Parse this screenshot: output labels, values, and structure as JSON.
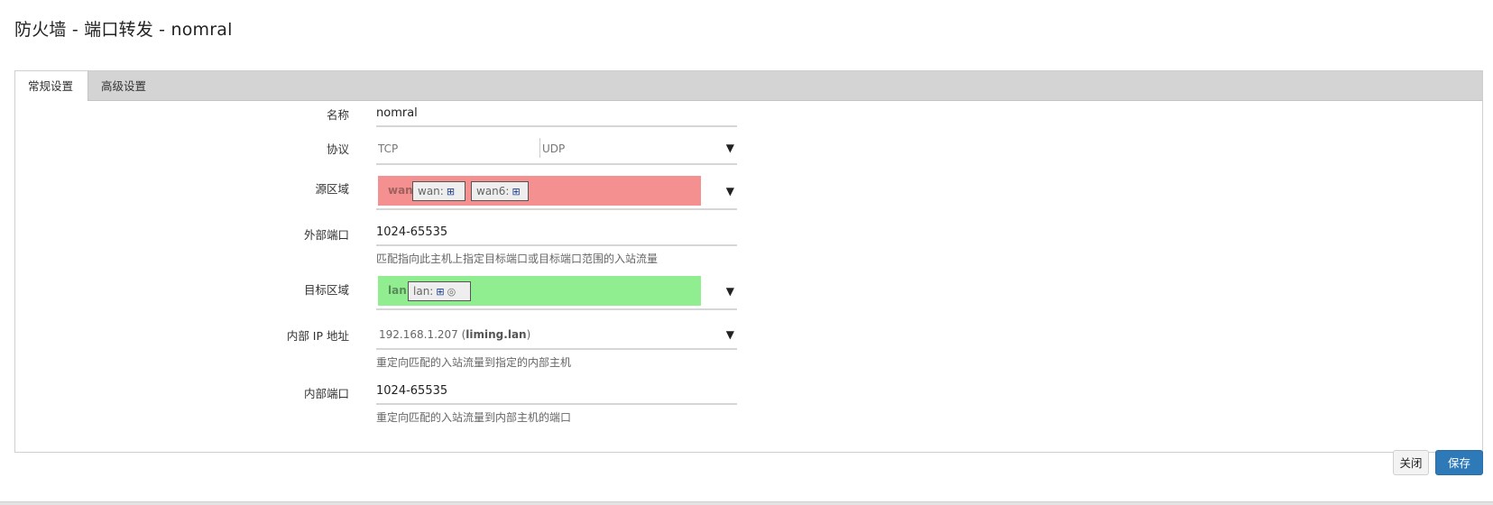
{
  "modal": {
    "title": "防火墙 - 端口转发 - nomral"
  },
  "tabs": [
    {
      "label": "常规设置",
      "active": true
    },
    {
      "label": "高级设置",
      "active": false
    }
  ],
  "form": {
    "name": {
      "label": "名称",
      "value": "nomral"
    },
    "protocol": {
      "label": "协议",
      "options": [
        "TCP",
        "UDP"
      ]
    },
    "source_zone": {
      "label": "源区域",
      "zone": "wan",
      "color": "#f59090",
      "chips": [
        {
          "label": "wan:",
          "icon": "network-adapter-icon"
        },
        {
          "label": "wan6:",
          "icon": "network-adapter-icon"
        }
      ]
    },
    "external_port": {
      "label": "外部端口",
      "value": "1024-65535",
      "description": "匹配指向此主机上指定目标端口或目标端口范围的入站流量"
    },
    "dest_zone": {
      "label": "目标区域",
      "zone": "lan",
      "color": "#90ee90",
      "chips": [
        {
          "label": "lan:",
          "icon": "network-adapter-icon",
          "extra_icon": "wireless-icon"
        }
      ]
    },
    "internal_ip": {
      "label": "内部 IP 地址",
      "value": "192.168.1.207",
      "hostname": "liming.lan",
      "description": "重定向匹配的入站流量到指定的内部主机"
    },
    "internal_port": {
      "label": "内部端口",
      "value": "1024-65535",
      "description": "重定向匹配的入站流量到内部主机的端口"
    }
  },
  "footer": {
    "close_label": "关闭",
    "save_label": "保存"
  }
}
